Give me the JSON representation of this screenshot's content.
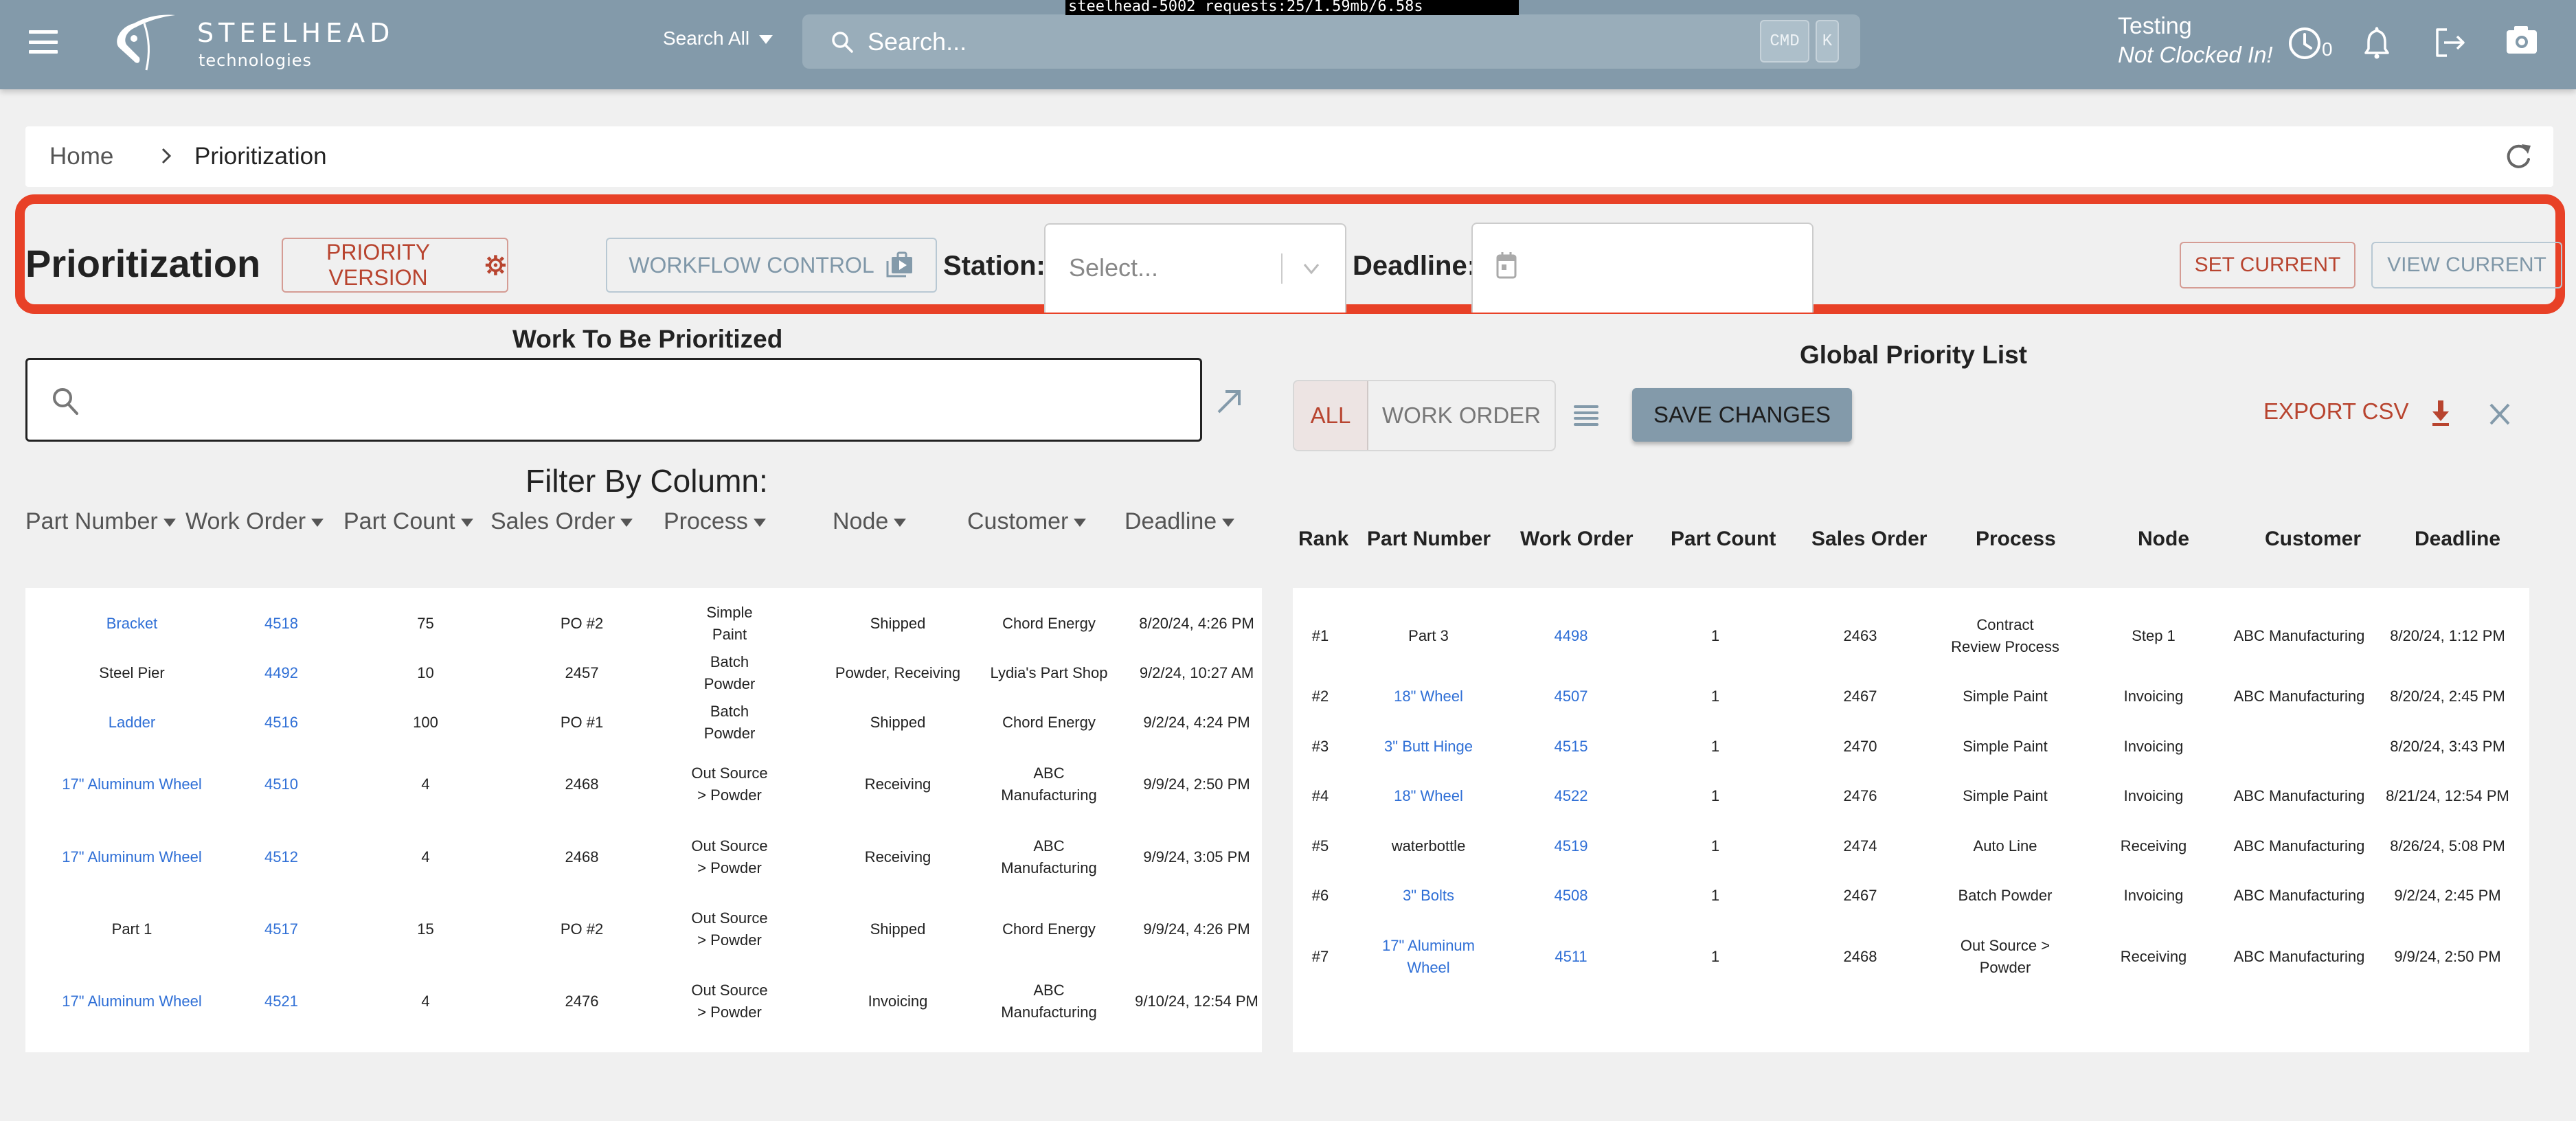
{
  "proxy_banner": "steelhead-5002 requests:25/1.59mb/6.58s",
  "header": {
    "brand_name": "STEELHEAD",
    "brand_sub": "technologies",
    "search_scope": "Search All",
    "search_placeholder": "Search...",
    "kbd_cmd": "CMD",
    "kbd_k": "K",
    "user_name": "Testing",
    "clock_status": "Not Clocked In!",
    "clock_count": "0",
    "icons": [
      "menu-icon",
      "clock-icon",
      "bell-icon",
      "logout-icon",
      "camera-icon"
    ]
  },
  "breadcrumb": {
    "home": "Home",
    "current": "Prioritization"
  },
  "toolbar": {
    "title": "Prioritization",
    "priority_version": "PRIORITY VERSION",
    "workflow_control": "WORKFLOW CONTROL",
    "station_label": "Station:",
    "station_placeholder": "Select...",
    "deadline_label": "Deadline:",
    "deadline_value": "",
    "set_current": "SET CURRENT",
    "view_current": "VIEW CURRENT",
    "colors": {
      "accent_red": "#b8442f",
      "accent_blue": "#839aaa",
      "highlight": "#e84127",
      "link": "#2f6fd6"
    }
  },
  "work_panel": {
    "title": "Work To Be Prioritized",
    "search_value": "",
    "filter_title": "Filter By Column:",
    "filters": [
      "Part Number",
      "Work Order",
      "Part Count",
      "Sales Order",
      "Process",
      "Node",
      "Customer",
      "Deadline"
    ],
    "rows": [
      {
        "part": "Bracket",
        "part_link": true,
        "wo": "4518",
        "count": "75",
        "so": "PO #2",
        "process": "Simple Paint",
        "node": "Shipped",
        "customer": "Chord Energy",
        "deadline": "8/20/24, 4:26 PM"
      },
      {
        "part": "Steel Pier",
        "part_link": false,
        "wo": "4492",
        "count": "10",
        "so": "2457",
        "process": "Batch Powder",
        "node": "Powder, Receiving",
        "customer": "Lydia's Part Shop",
        "deadline": "9/2/24, 10:27 AM"
      },
      {
        "part": "Ladder",
        "part_link": true,
        "wo": "4516",
        "count": "100",
        "so": "PO #1",
        "process": "Batch Powder",
        "node": "Shipped",
        "customer": "Chord Energy",
        "deadline": "9/2/24, 4:24 PM"
      },
      {
        "part": "17\" Aluminum Wheel",
        "part_link": true,
        "wo": "4510",
        "count": "4",
        "so": "2468",
        "process": "Out Source > Powder",
        "node": "Receiving",
        "customer": "ABC Manufacturing",
        "deadline": "9/9/24, 2:50 PM"
      },
      {
        "part": "17\" Aluminum Wheel",
        "part_link": true,
        "wo": "4512",
        "count": "4",
        "so": "2468",
        "process": "Out Source > Powder",
        "node": "Receiving",
        "customer": "ABC Manufacturing",
        "deadline": "9/9/24, 3:05 PM"
      },
      {
        "part": "Part 1",
        "part_link": false,
        "wo": "4517",
        "count": "15",
        "so": "PO #2",
        "process": "Out Source > Powder",
        "node": "Shipped",
        "customer": "Chord Energy",
        "deadline": "9/9/24, 4:26 PM"
      },
      {
        "part": "17\" Aluminum Wheel",
        "part_link": true,
        "wo": "4521",
        "count": "4",
        "so": "2476",
        "process": "Out Source > Powder",
        "node": "Invoicing",
        "customer": "ABC Manufacturing",
        "deadline": "9/10/24, 12:54 PM"
      }
    ]
  },
  "global_panel": {
    "title": "Global Priority List",
    "seg_all": "ALL",
    "seg_work_order": "WORK ORDER",
    "save_changes": "SAVE CHANGES",
    "export_csv": "EXPORT CSV",
    "columns": [
      "Rank",
      "Part Number",
      "Work Order",
      "Part Count",
      "Sales Order",
      "Process",
      "Node",
      "Customer",
      "Deadline"
    ],
    "rows": [
      {
        "rank": "#1",
        "part": "Part 3",
        "part_link": false,
        "wo": "4498",
        "count": "1",
        "so": "2463",
        "process": "Contract Review Process",
        "node": "Step 1",
        "customer": "ABC Manufacturing",
        "deadline": "8/20/24, 1:12 PM"
      },
      {
        "rank": "#2",
        "part": "18\" Wheel",
        "part_link": true,
        "wo": "4507",
        "count": "1",
        "so": "2467",
        "process": "Simple Paint",
        "node": "Invoicing",
        "customer": "ABC Manufacturing",
        "deadline": "8/20/24, 2:45 PM"
      },
      {
        "rank": "#3",
        "part": "3\" Butt Hinge",
        "part_link": true,
        "wo": "4515",
        "count": "1",
        "so": "2470",
        "process": "Simple Paint",
        "node": "Invoicing",
        "customer": "",
        "deadline": "8/20/24, 3:43 PM"
      },
      {
        "rank": "#4",
        "part": "18\" Wheel",
        "part_link": true,
        "wo": "4522",
        "count": "1",
        "so": "2476",
        "process": "Simple Paint",
        "node": "Invoicing",
        "customer": "ABC Manufacturing",
        "deadline": "8/21/24, 12:54 PM"
      },
      {
        "rank": "#5",
        "part": "waterbottle",
        "part_link": false,
        "wo": "4519",
        "count": "1",
        "so": "2474",
        "process": "Auto Line",
        "node": "Receiving",
        "customer": "ABC Manufacturing",
        "deadline": "8/26/24, 5:08 PM"
      },
      {
        "rank": "#6",
        "part": "3\" Bolts",
        "part_link": true,
        "wo": "4508",
        "count": "1",
        "so": "2467",
        "process": "Batch Powder",
        "node": "Invoicing",
        "customer": "ABC Manufacturing",
        "deadline": "9/2/24, 2:45 PM"
      },
      {
        "rank": "#7",
        "part": "17\" Aluminum Wheel",
        "part_link": true,
        "wo": "4511",
        "count": "1",
        "so": "2468",
        "process": "Out Source > Powder",
        "node": "Receiving",
        "customer": "ABC Manufacturing",
        "deadline": "9/9/24, 2:50 PM"
      }
    ]
  }
}
